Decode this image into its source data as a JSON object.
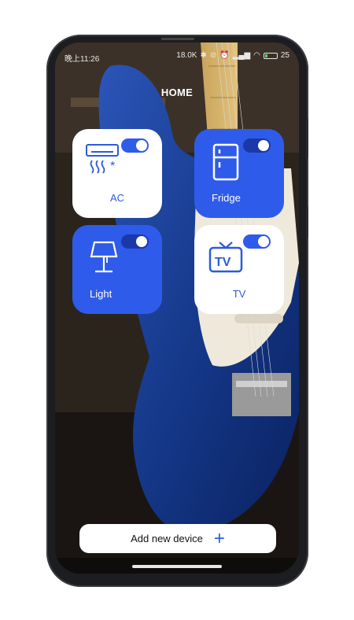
{
  "status_bar": {
    "time": "晚上11:26",
    "net_speed": "18.0K",
    "battery": "25",
    "battery_level": 0.25,
    "icons": [
      "bluetooth-icon",
      "mute-icon",
      "alarm-icon",
      "signal-icon",
      "wifi-icon",
      "battery-icon"
    ]
  },
  "page": {
    "title": "HOME"
  },
  "devices": [
    {
      "name": "AC",
      "icon": "air-conditioner-icon",
      "on": true,
      "style": "white"
    },
    {
      "name": "Fridge",
      "icon": "fridge-icon",
      "on": true,
      "style": "blue"
    },
    {
      "name": "Light",
      "icon": "lamp-icon",
      "on": true,
      "style": "blue"
    },
    {
      "name": "TV",
      "icon": "tv-icon",
      "on": true,
      "style": "white"
    }
  ],
  "add_button": {
    "label": "Add new device",
    "icon": "plus-icon"
  },
  "colors": {
    "accent": "#2f5bea",
    "card_white": "#ffffff",
    "text_dark": "#111111"
  }
}
